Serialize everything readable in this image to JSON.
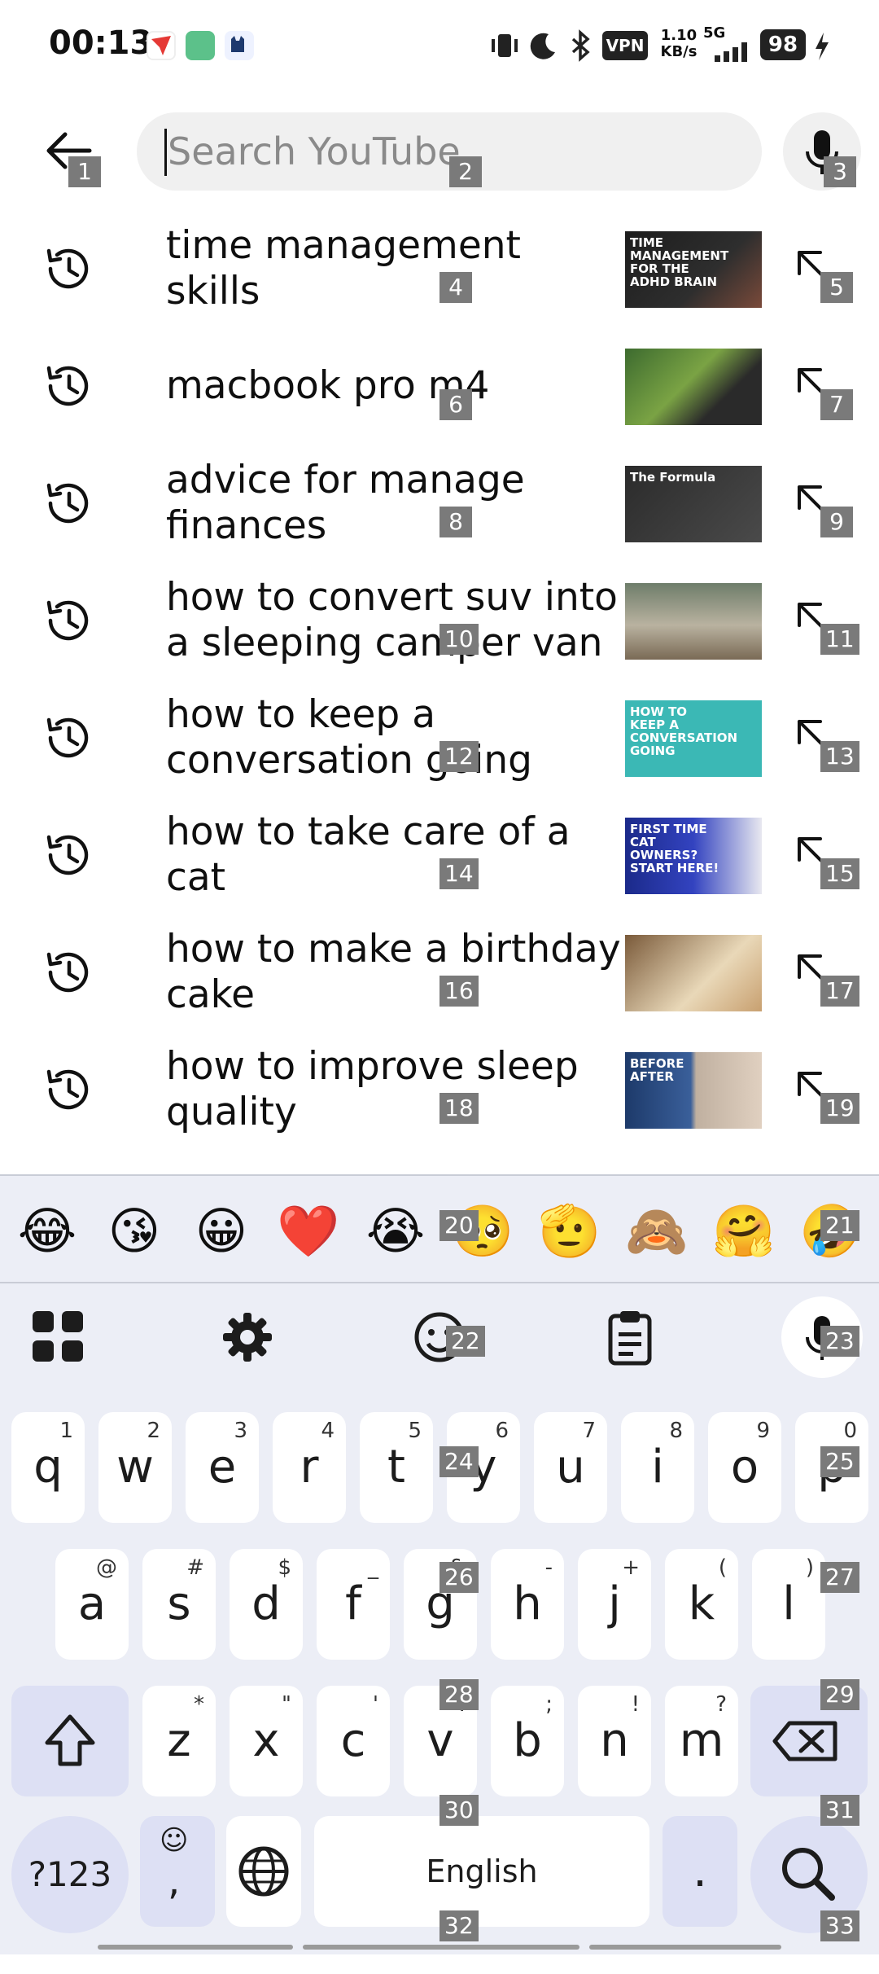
{
  "status_bar": {
    "time": "00:13",
    "vpn": "VPN",
    "net_speed_value": "1.10",
    "net_speed_unit": "KB/s",
    "net_type": "5G",
    "battery": "98"
  },
  "search": {
    "placeholder": "Search YouTube",
    "value": ""
  },
  "suggestions": [
    {
      "text": "time management skills",
      "thumb_label": "TIME MANAGEMENT FOR THE ADHD BRAIN"
    },
    {
      "text": "macbook pro m4",
      "thumb_label": ""
    },
    {
      "text": "advice for manage finances",
      "thumb_label": "The Formula"
    },
    {
      "text": "how to convert suv into a sleeping camper van",
      "thumb_label": ""
    },
    {
      "text": "how to keep a conversation going",
      "thumb_label": "HOW TO KEEP A CONVERSATION GOING"
    },
    {
      "text": "how to take care of a cat",
      "thumb_label": "FIRST TIME CAT OWNERS? START HERE!"
    },
    {
      "text": "how to make a birthday cake",
      "thumb_label": ""
    },
    {
      "text": "how to improve sleep quality",
      "thumb_label": "BEFORE AFTER"
    }
  ],
  "emoji_bar": [
    "😂",
    "😘",
    "😀",
    "❤️",
    "😭",
    "🥺",
    "🫡",
    "🙈",
    "🤗",
    "🤣"
  ],
  "keyboard": {
    "row1": [
      {
        "k": "q",
        "h": "1"
      },
      {
        "k": "w",
        "h": "2"
      },
      {
        "k": "e",
        "h": "3"
      },
      {
        "k": "r",
        "h": "4"
      },
      {
        "k": "t",
        "h": "5"
      },
      {
        "k": "y",
        "h": "6"
      },
      {
        "k": "u",
        "h": "7"
      },
      {
        "k": "i",
        "h": "8"
      },
      {
        "k": "o",
        "h": "9"
      },
      {
        "k": "p",
        "h": "0"
      }
    ],
    "row2": [
      {
        "k": "a",
        "h": "@"
      },
      {
        "k": "s",
        "h": "#"
      },
      {
        "k": "d",
        "h": "$"
      },
      {
        "k": "f",
        "h": "_"
      },
      {
        "k": "g",
        "h": "&"
      },
      {
        "k": "h",
        "h": "-"
      },
      {
        "k": "j",
        "h": "+"
      },
      {
        "k": "k",
        "h": "("
      },
      {
        "k": "l",
        "h": ")"
      }
    ],
    "row3": [
      {
        "k": "z",
        "h": "*"
      },
      {
        "k": "x",
        "h": "\""
      },
      {
        "k": "c",
        "h": "'"
      },
      {
        "k": "v",
        "h": ":"
      },
      {
        "k": "b",
        "h": ";"
      },
      {
        "k": "n",
        "h": "!"
      },
      {
        "k": "m",
        "h": "?"
      }
    ],
    "symbols_label": "?123",
    "comma_label": ",",
    "space_label": "English",
    "period_label": "."
  },
  "badges": [
    "1",
    "2",
    "3",
    "4",
    "5",
    "6",
    "7",
    "8",
    "9",
    "10",
    "11",
    "12",
    "13",
    "14",
    "15",
    "16",
    "17",
    "18",
    "19",
    "20",
    "21",
    "22",
    "23",
    "24",
    "25",
    "26",
    "27",
    "28",
    "29",
    "30",
    "31",
    "32",
    "33"
  ],
  "colors": {
    "accent": "#dde0f4",
    "keyboard_bg": "#eceef6",
    "search_bg": "#f0f0f0"
  }
}
